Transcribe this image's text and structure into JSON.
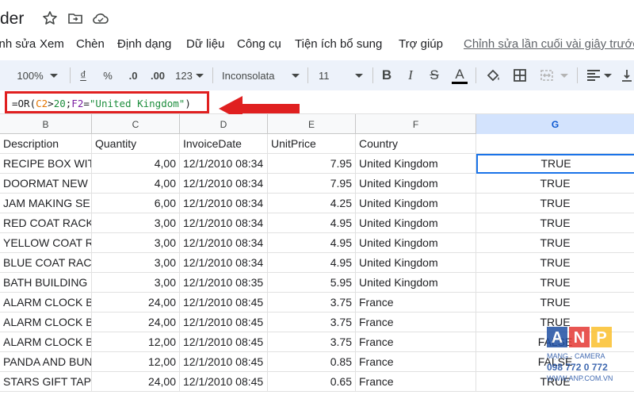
{
  "title": {
    "doc_name": "der"
  },
  "menu": {
    "items": [
      "Chỉnh sửa",
      "Xem",
      "Chèn",
      "Định dạng",
      "Dữ liệu",
      "Công cụ",
      "Tiện ích bổ sung",
      "Trợ giúp"
    ],
    "last_edit": "Chỉnh sửa lần cuối vài giây trước"
  },
  "toolbar": {
    "zoom": "100%",
    "currency": "₫",
    "percent": "%",
    "dec_decrease": ".0",
    "dec_increase": ".00",
    "format_more": "123",
    "font": "Inconsolata",
    "font_size": "11",
    "bold": "B",
    "italic": "I",
    "strike": "S",
    "text_color": "A"
  },
  "formula": {
    "prefix": "=OR(",
    "ref1": "C2",
    "op1": ">",
    "num": "20",
    "sep": ";",
    "ref2": "F2",
    "op2": "=",
    "str": "\"United Kingdom\"",
    "suffix": ")"
  },
  "columns": [
    "B",
    "C",
    "D",
    "E",
    "F",
    "G"
  ],
  "headers": [
    "Description",
    "Quantity",
    "InvoiceDate",
    "UnitPrice",
    "Country",
    ""
  ],
  "rows": [
    [
      "RECIPE BOX WIT",
      "4,00",
      "12/1/2010 08:34",
      "7.95",
      "United Kingdom",
      "TRUE"
    ],
    [
      "DOORMAT NEW",
      "4,00",
      "12/1/2010 08:34",
      "7.95",
      "United Kingdom",
      "TRUE"
    ],
    [
      "JAM MAKING SE",
      "6,00",
      "12/1/2010 08:34",
      "4.25",
      "United Kingdom",
      "TRUE"
    ],
    [
      "RED COAT RACK",
      "3,00",
      "12/1/2010 08:34",
      "4.95",
      "United Kingdom",
      "TRUE"
    ],
    [
      "YELLOW COAT R",
      "3,00",
      "12/1/2010 08:34",
      "4.95",
      "United Kingdom",
      "TRUE"
    ],
    [
      "BLUE COAT RACK",
      "3,00",
      "12/1/2010 08:34",
      "4.95",
      "United Kingdom",
      "TRUE"
    ],
    [
      "BATH BUILDING",
      "3,00",
      "12/1/2010 08:35",
      "5.95",
      "United Kingdom",
      "TRUE"
    ],
    [
      "ALARM CLOCK B",
      "24,00",
      "12/1/2010 08:45",
      "3.75",
      "France",
      "TRUE"
    ],
    [
      "ALARM CLOCK B",
      "24,00",
      "12/1/2010 08:45",
      "3.75",
      "France",
      "TRUE"
    ],
    [
      "ALARM CLOCK B",
      "12,00",
      "12/1/2010 08:45",
      "3.75",
      "France",
      "FALSE"
    ],
    [
      "PANDA AND BUN",
      "12,00",
      "12/1/2010 08:45",
      "0.85",
      "France",
      "FALSE"
    ],
    [
      "STARS GIFT TAPE",
      "24,00",
      "12/1/2010 08:45",
      "0.65",
      "France",
      "TRUE"
    ]
  ],
  "watermark": {
    "brand": "ANP",
    "line1": "MẠNG · CAMERA",
    "phone": "098 772 0 772",
    "site": "WWW.ANP.COM.VN"
  },
  "colors": {
    "highlight_red": "#e02020",
    "selection_blue": "#1a73e8",
    "toolbar_bg": "#edf2fa"
  }
}
